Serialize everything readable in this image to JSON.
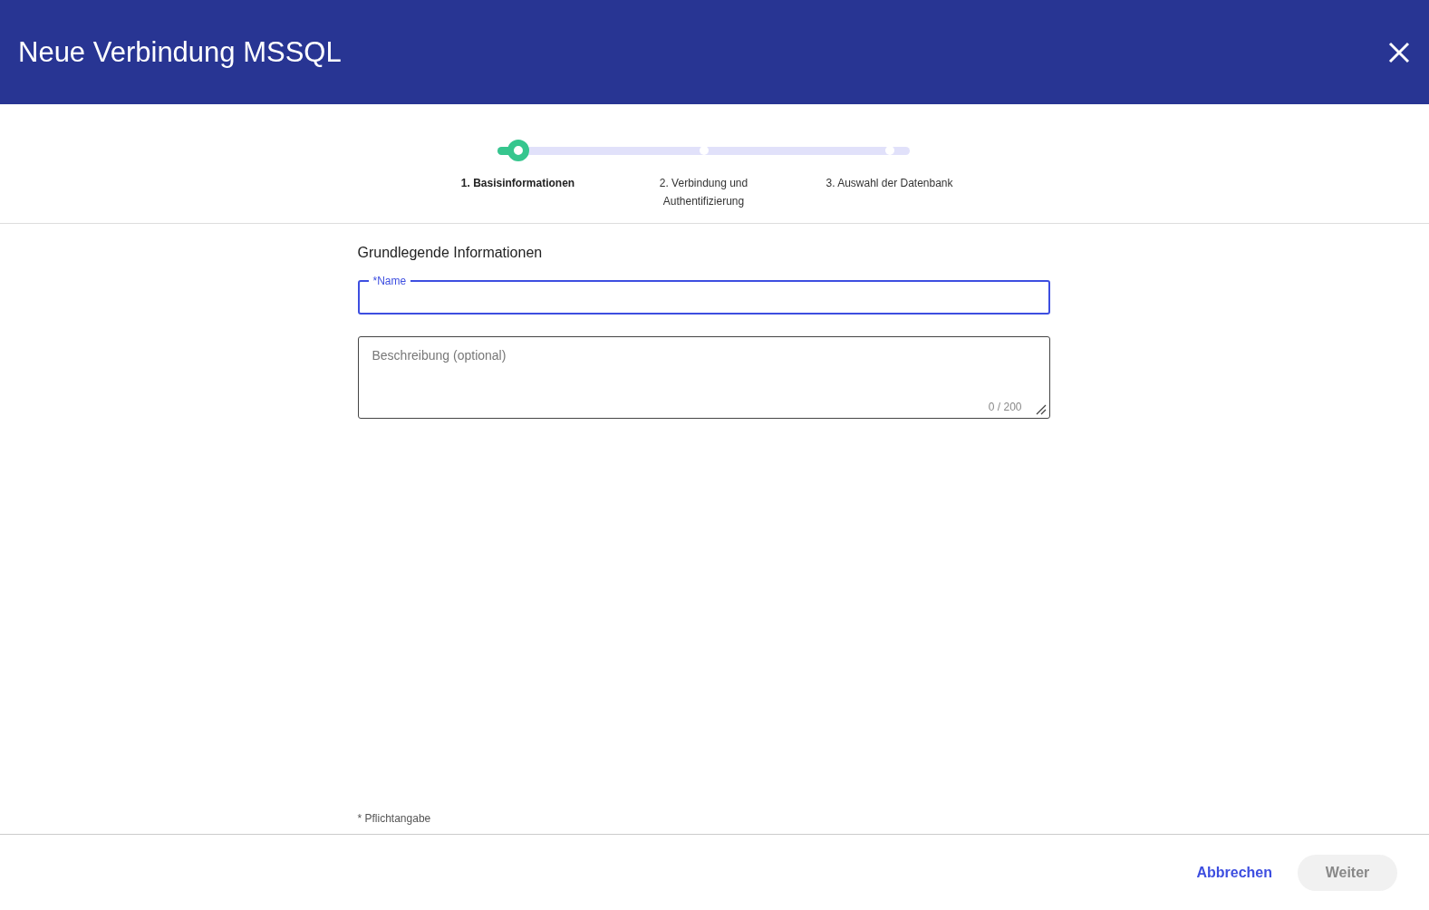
{
  "dialog": {
    "title": "Neue Verbindung MSSQL"
  },
  "steps": [
    {
      "label": "1. Basisinformationen",
      "selected": true
    },
    {
      "label": "2. Verbindung und Authentifizierung",
      "selected": false
    },
    {
      "label": "3. Auswahl der Datenbank",
      "selected": false
    }
  ],
  "section_title": "Grundlegende Informationen",
  "name_field": {
    "label": "*Name",
    "focused": true
  },
  "description_field": {
    "placeholder": "Beschreibung (optional)",
    "counter": "0 / 200"
  },
  "required_note": "* Pflichtangabe",
  "buttons": [
    {
      "label": "Abbrechen",
      "kind": "text",
      "disabled": false
    },
    {
      "label": "Weiter",
      "kind": "filled",
      "disabled": true
    }
  ]
}
